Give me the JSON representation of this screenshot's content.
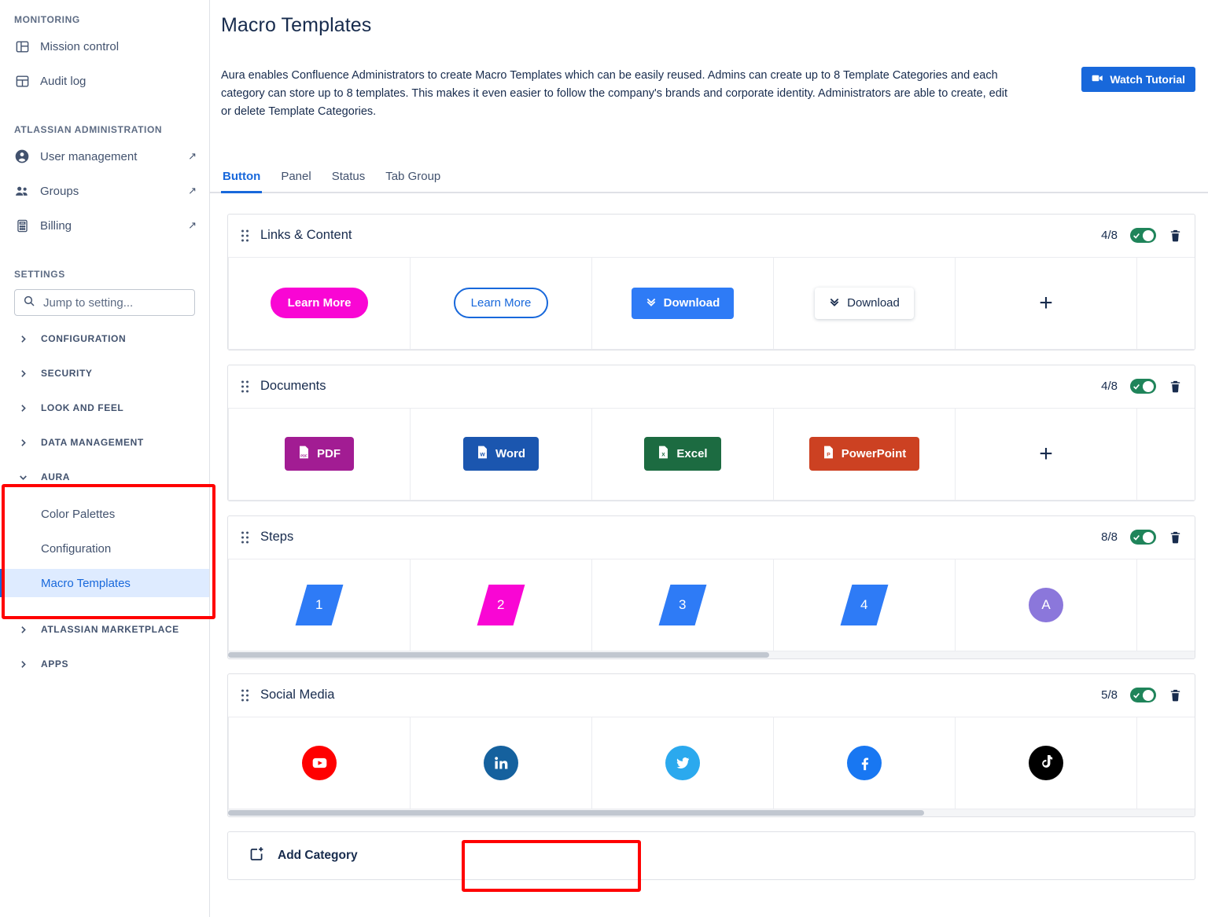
{
  "sidebar": {
    "sections": [
      {
        "heading": "MONITORING",
        "items": [
          {
            "label": "Mission control",
            "icon": "dashboard-icon",
            "external": false
          },
          {
            "label": "Audit log",
            "icon": "grid-icon",
            "external": false
          }
        ]
      },
      {
        "heading": "ATLASSIAN ADMINISTRATION",
        "items": [
          {
            "label": "User management",
            "icon": "person-icon",
            "external": true
          },
          {
            "label": "Groups",
            "icon": "people-icon",
            "external": true
          },
          {
            "label": "Billing",
            "icon": "billing-icon",
            "external": true
          }
        ]
      }
    ],
    "settings_heading": "SETTINGS",
    "search": {
      "placeholder": "Jump to setting...",
      "value": "",
      "icon": "search-icon"
    },
    "groups": [
      {
        "label": "CONFIGURATION",
        "expanded": false
      },
      {
        "label": "SECURITY",
        "expanded": false
      },
      {
        "label": "LOOK AND FEEL",
        "expanded": false
      },
      {
        "label": "DATA MANAGEMENT",
        "expanded": false
      },
      {
        "label": "AURA",
        "expanded": true
      }
    ],
    "aura_items": [
      {
        "label": "Color Palettes",
        "active": false
      },
      {
        "label": "Configuration",
        "active": false
      },
      {
        "label": "Macro Templates",
        "active": true
      }
    ],
    "groups_after": [
      {
        "label": "ATLASSIAN MARKETPLACE",
        "expanded": false
      },
      {
        "label": "APPS",
        "expanded": false
      }
    ],
    "highlight_color": "#FF0000"
  },
  "header": {
    "title": "Macro Templates",
    "description": "Aura enables Confluence Administrators to create Macro Templates which can be easily reused. Admins can create up to 8 Template Categories and each category can store up to 8 templates. This makes it even easier to follow the company's brands and corporate identity. Administrators are able to create, edit or delete Template Categories.",
    "watch_tutorial_label": "Watch Tutorial",
    "watch_tutorial_icon": "video-camera-icon"
  },
  "tabs": [
    {
      "label": "Button",
      "active": true
    },
    {
      "label": "Panel",
      "active": false
    },
    {
      "label": "Status",
      "active": false
    },
    {
      "label": "Tab Group",
      "active": false
    }
  ],
  "categories": [
    {
      "name": "Links & Content",
      "count": "4/8",
      "enabled": true,
      "scrollbar": false,
      "templates": [
        {
          "kind": "pill",
          "label": "Learn More",
          "color": "#F906D4",
          "text_color": "#FFFFFF"
        },
        {
          "kind": "outline",
          "label": "Learn More",
          "color": "#1868DB",
          "text_color": "#1868DB"
        },
        {
          "kind": "solid",
          "label": "Download",
          "color": "#2E7BF6",
          "text_color": "#FFFFFF",
          "icon": "double-chevron-down-icon"
        },
        {
          "kind": "white",
          "label": "Download",
          "color": "#FFFFFF",
          "text_color": "#172B4D",
          "icon": "double-chevron-down-icon"
        },
        {
          "kind": "add",
          "label": "+"
        }
      ]
    },
    {
      "name": "Documents",
      "count": "4/8",
      "enabled": true,
      "scrollbar": false,
      "templates": [
        {
          "kind": "file",
          "label": "PDF",
          "color": "#A21C93",
          "text_color": "#FFFFFF",
          "icon": "pdf-file-icon"
        },
        {
          "kind": "file",
          "label": "Word",
          "color": "#1B56AF",
          "text_color": "#FFFFFF",
          "icon": "word-file-icon"
        },
        {
          "kind": "file",
          "label": "Excel",
          "color": "#1C6B41",
          "text_color": "#FFFFFF",
          "icon": "excel-file-icon"
        },
        {
          "kind": "file",
          "label": "PowerPoint",
          "color": "#CC4122",
          "text_color": "#FFFFFF",
          "icon": "powerpoint-file-icon"
        },
        {
          "kind": "add",
          "label": "+"
        }
      ]
    },
    {
      "name": "Steps",
      "count": "8/8",
      "enabled": true,
      "scrollbar": true,
      "scroll_thumb_percent": 56,
      "templates": [
        {
          "kind": "step",
          "label": "1",
          "color": "#2E7BF6",
          "text_color": "#FFFFFF"
        },
        {
          "kind": "step",
          "label": "2",
          "color": "#F906D4",
          "text_color": "#FFFFFF"
        },
        {
          "kind": "step",
          "label": "3",
          "color": "#2E7BF6",
          "text_color": "#FFFFFF"
        },
        {
          "kind": "step",
          "label": "4",
          "color": "#2E7BF6",
          "text_color": "#FFFFFF"
        },
        {
          "kind": "avatar",
          "label": "A",
          "color": "#8B77DB",
          "text_color": "#FFFFFF"
        },
        {
          "kind": "partial",
          "label": ""
        }
      ]
    },
    {
      "name": "Social Media",
      "count": "5/8",
      "enabled": true,
      "scrollbar": true,
      "scroll_thumb_percent": 72,
      "templates": [
        {
          "kind": "social",
          "label": "",
          "icon": "youtube-icon",
          "color": "#FF0000",
          "text_color": "#FFFFFF"
        },
        {
          "kind": "social",
          "label": "",
          "icon": "linkedin-icon",
          "color": "#15619E",
          "text_color": "#FFFFFF"
        },
        {
          "kind": "social",
          "label": "",
          "icon": "twitter-icon",
          "color": "#2BA9EE",
          "text_color": "#FFFFFF"
        },
        {
          "kind": "social",
          "label": "",
          "icon": "facebook-icon",
          "color": "#1877F2",
          "text_color": "#FFFFFF"
        },
        {
          "kind": "social",
          "label": "",
          "icon": "tiktok-icon",
          "color": "#000000",
          "text_color": "#FFFFFF"
        },
        {
          "kind": "partial",
          "label": ""
        }
      ]
    }
  ],
  "footer": {
    "add_category_label": "Add Category",
    "add_category_icon": "add-frame-icon"
  },
  "colors": {
    "accent": "#1868DB",
    "toggle_on": "#1F845A",
    "annotation": "#FF0000",
    "text": "#172B4D",
    "muted": "#42526E"
  }
}
